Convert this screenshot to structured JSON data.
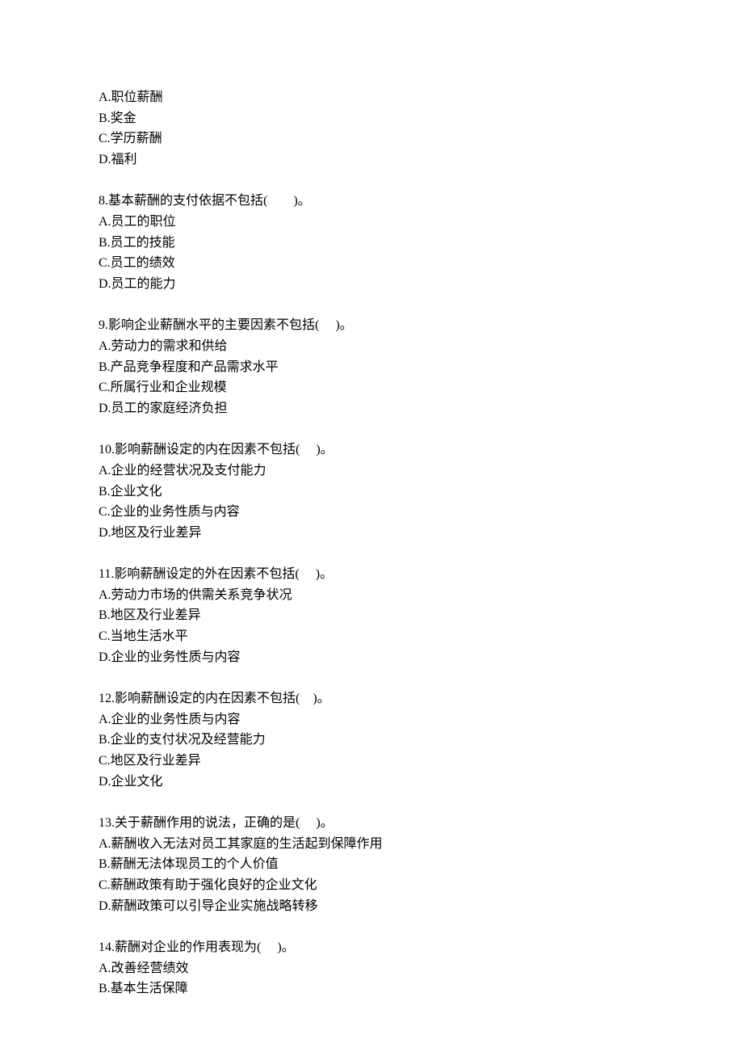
{
  "partial_options": {
    "a": "A.职位薪酬",
    "b": "B.奖金",
    "c": "C.学历薪酬",
    "d": "D.福利"
  },
  "questions": [
    {
      "stem": "8.基本薪酬的支付依据不包括(　　)。",
      "a": "A.员工的职位",
      "b": "B.员工的技能",
      "c": "C.员工的绩效",
      "d": "D.员工的能力"
    },
    {
      "stem": "9.影响企业薪酬水平的主要因素不包括(　 )。",
      "a": "A.劳动力的需求和供给",
      "b": "B.产品竞争程度和产品需求水平",
      "c": "C.所属行业和企业规模",
      "d": "D.员工的家庭经济负担"
    },
    {
      "stem": "10.影响薪酬设定的内在因素不包括(　 )。",
      "a": "A.企业的经营状况及支付能力",
      "b": "B.企业文化",
      "c": "C.企业的业务性质与内容",
      "d": "D.地区及行业差异"
    },
    {
      "stem": "11.影响薪酬设定的外在因素不包括(　 )。",
      "a": "A.劳动力市场的供需关系竞争状况",
      "b": "B.地区及行业差异",
      "c": "C.当地生活水平",
      "d": "D.企业的业务性质与内容"
    },
    {
      "stem": "12.影响薪酬设定的内在因素不包括(　)。",
      "a": "A.企业的业务性质与内容",
      "b": "B.企业的支付状况及经营能力",
      "c": "C.地区及行业差异",
      "d": "D.企业文化"
    },
    {
      "stem": "13.关于薪酬作用的说法，正确的是(　 )。",
      "a": "A.薪酬收入无法对员工其家庭的生活起到保障作用",
      "b": "B.薪酬无法体现员工的个人价值",
      "c": "C.薪酬政策有助于强化良好的企业文化",
      "d": "D.薪酬政策可以引导企业实施战略转移"
    }
  ],
  "partial_question": {
    "stem": "14.薪酬对企业的作用表现为(　 )。",
    "a": "A.改善经营绩效",
    "b": "B.基本生活保障"
  }
}
